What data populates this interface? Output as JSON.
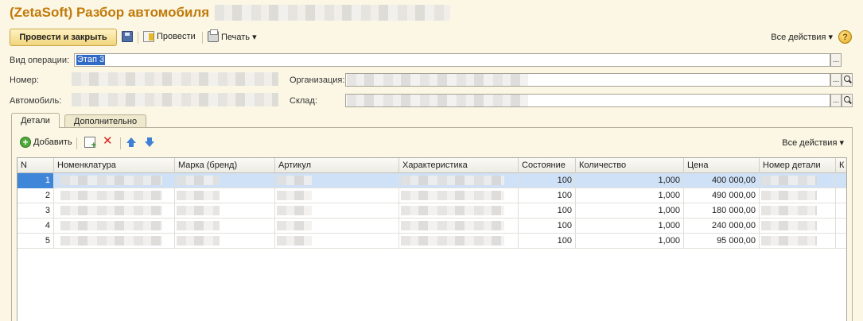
{
  "window": {
    "title": "(ZetaSoft) Разбор автомобиля"
  },
  "toolbar": {
    "post_and_close": "Провести и закрыть",
    "post": "Провести",
    "print": "Печать ▾",
    "all_actions": "Все действия ▾",
    "help": "?"
  },
  "form": {
    "operation_type_label": "Вид операции:",
    "operation_type_value": "Этап 3",
    "number_label": "Номер:",
    "organization_label": "Организация:",
    "car_label": "Автомобиль:",
    "warehouse_label": "Склад:",
    "ellipsis": "..."
  },
  "tabs": [
    {
      "label": "Детали",
      "active": true
    },
    {
      "label": "Дополнительно",
      "active": false
    }
  ],
  "details_toolbar": {
    "add": "Добавить",
    "all_actions": "Все действия ▾"
  },
  "table": {
    "columns": [
      "N",
      "Номенклатура",
      "Марка (бренд)",
      "Артикул",
      "Характеристика",
      "Состояние",
      "Количество",
      "Цена",
      "Номер детали",
      "К"
    ],
    "rows": [
      {
        "n": "1",
        "state": "100",
        "qty": "1,000",
        "price": "400 000,00",
        "selected": true
      },
      {
        "n": "2",
        "state": "100",
        "qty": "1,000",
        "price": "490 000,00",
        "selected": false
      },
      {
        "n": "3",
        "state": "100",
        "qty": "1,000",
        "price": "180 000,00",
        "selected": false
      },
      {
        "n": "4",
        "state": "100",
        "qty": "1,000",
        "price": "240 000,00",
        "selected": false
      },
      {
        "n": "5",
        "state": "100",
        "qty": "1,000",
        "price": "95 000,00",
        "selected": false
      }
    ]
  }
}
